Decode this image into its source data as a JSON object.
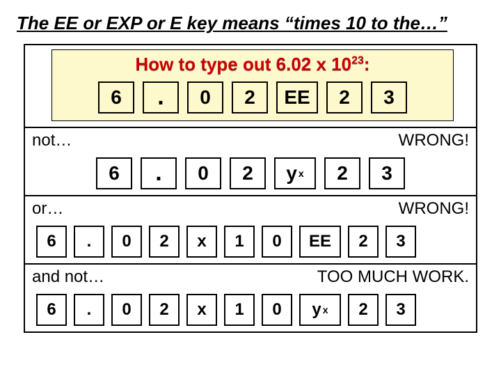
{
  "title": "The EE or EXP or E key means “times 10 to the…”",
  "howto_shadow": "How to type out 6.02 x 10",
  "howto_red": "How to type out 6.02 x 10",
  "howto_exp_a": "23",
  "howto_exp_b": "23",
  "howto_colon": ":",
  "row1": [
    "6",
    ".",
    "0",
    "2",
    "EE",
    "2",
    "3"
  ],
  "sec_not": {
    "left": "not…",
    "right": "WRONG!"
  },
  "row2": [
    "6",
    ".",
    "0",
    "2",
    "y",
    "2",
    "3"
  ],
  "row2_sup": "x",
  "sec_or": {
    "left": "or…",
    "right": "WRONG!"
  },
  "row3": [
    "6",
    ".",
    "0",
    "2",
    "x",
    "1",
    "0",
    "EE",
    "2",
    "3"
  ],
  "sec_andnot": {
    "left": "and not…",
    "right": "TOO MUCH WORK."
  },
  "row4": [
    "6",
    ".",
    "0",
    "2",
    "x",
    "1",
    "0",
    "y",
    "2",
    "3"
  ],
  "row4_sup": "x"
}
